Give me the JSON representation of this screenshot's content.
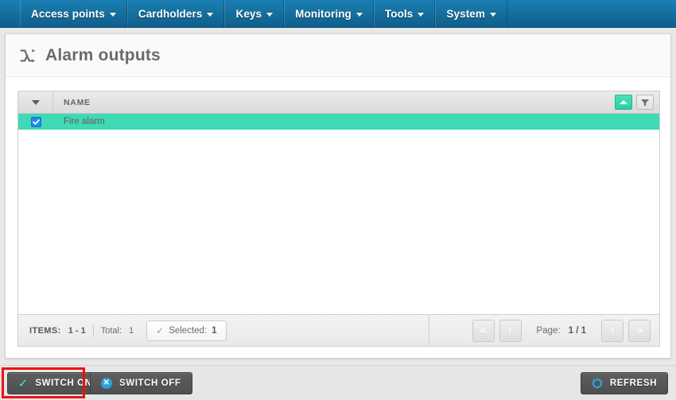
{
  "navbar": {
    "items": [
      {
        "label": "Access points",
        "icon": "chevron-down-icon"
      },
      {
        "label": "Cardholders",
        "icon": "chevron-down-icon"
      },
      {
        "label": "Keys",
        "icon": "chevron-down-icon"
      },
      {
        "label": "Monitoring",
        "icon": "chevron-down-icon"
      },
      {
        "label": "Tools",
        "icon": "chevron-down-icon"
      },
      {
        "label": "System",
        "icon": "chevron-down-icon"
      }
    ]
  },
  "page": {
    "title": "Alarm outputs",
    "title_icon": "shuffle-icon"
  },
  "grid": {
    "select_all_icon": "chevron-down-icon",
    "columns": [
      "NAME"
    ],
    "sort_button": {
      "icon": "sort-ascending-icon",
      "state": "active"
    },
    "filter_button": {
      "icon": "filter-funnel-icon",
      "state": "inactive"
    },
    "rows": [
      {
        "name": "Fire alarm",
        "selected": true
      }
    ]
  },
  "footer": {
    "items_label": "ITEMS:",
    "items_range": "1 - 1",
    "total_label": "Total:",
    "total_value": "1",
    "selected_button": {
      "icon": "check-icon",
      "label": "Selected:",
      "value": "1"
    },
    "pager": {
      "first_icon": "double-chevron-left-icon",
      "prev_icon": "chevron-left-icon",
      "first_glyph": "«",
      "prev_glyph": "‹",
      "next_glyph": "›",
      "last_glyph": "»",
      "next_icon": "chevron-right-icon",
      "last_icon": "double-chevron-right-icon",
      "page_label": "Page:",
      "page_value": "1 / 1"
    }
  },
  "actions": {
    "switch_on": {
      "label": "SWITCH ON",
      "icon": "check-icon",
      "highlighted": true
    },
    "switch_off": {
      "label": "SWITCH OFF",
      "icon": "circle-x-icon",
      "glyph": "✕"
    },
    "refresh": {
      "label": "REFRESH",
      "icon": "refresh-circle-icon"
    }
  },
  "colors": {
    "navbar_blue": "#16709f",
    "row_selected_teal": "#40d9b5",
    "checkbox_blue": "#1e8ae8",
    "accent_cyan": "#3fd0e0",
    "action_button_gray": "#565656",
    "highlight_red": "#ee1111",
    "page_background": "#e8e8e8"
  }
}
